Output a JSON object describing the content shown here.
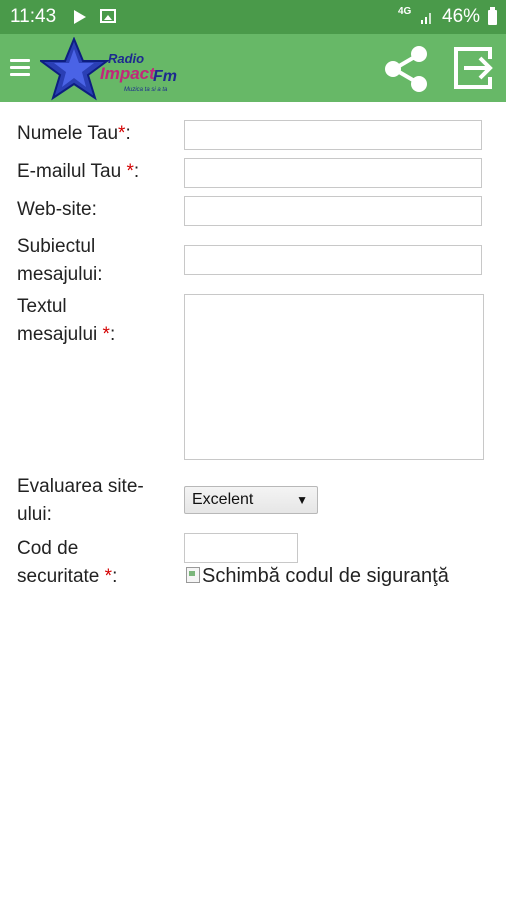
{
  "status_bar": {
    "time": "11:43",
    "network": "4G",
    "battery": "46%"
  },
  "app_bar": {
    "logo_text": "Radio Impact Fm",
    "logo_tagline": "Muzica ta si a ta",
    "icons": [
      "menu-icon",
      "share-icon",
      "exit-icon"
    ],
    "colors": {
      "status_bar": "#4a9a4a",
      "app_bar": "#67b867"
    }
  },
  "form": {
    "name_label": "Numele Tau",
    "email_label": "E-mailul Tau ",
    "website_label": "Web-site:",
    "subject_label_1": "Subiectul",
    "subject_label_2": "mesajului:",
    "message_label_1": "Textul",
    "message_label_2": "mesajului ",
    "rating_label_1": "Evaluarea site-",
    "rating_label_2": "ului:",
    "rating_value": "Excelent",
    "captcha_label_1": "Cod de",
    "captcha_label_2": "securitate ",
    "captcha_image_alt": "Schimbă codul de siguranţă",
    "required_mark": "*",
    "colon": ":",
    "name_value": "",
    "email_value": "",
    "website_value": "",
    "subject_value": "",
    "message_value": "",
    "captcha_value": ""
  }
}
